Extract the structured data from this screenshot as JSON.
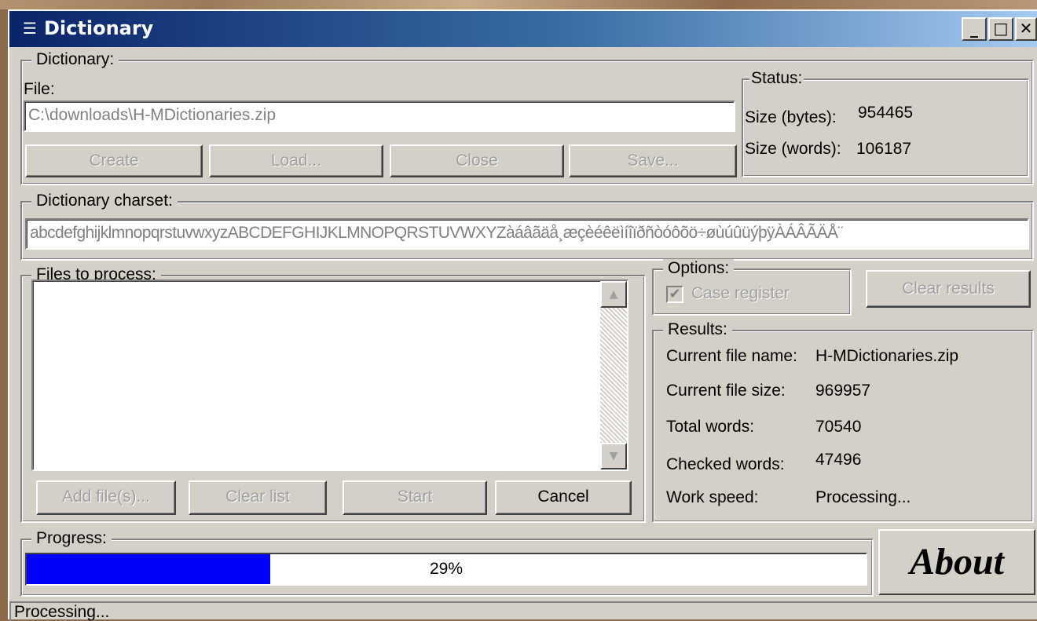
{
  "window": {
    "title": "Dictionary"
  },
  "dictionary": {
    "legend": "Dictionary:",
    "file_label": "File:",
    "file_value": "C:\\downloads\\H-MDictionaries.zip",
    "buttons": {
      "create": "Create",
      "load": "Load...",
      "close": "Close",
      "save": "Save..."
    }
  },
  "status": {
    "legend": "Status:",
    "size_bytes_label": "Size (bytes):",
    "size_bytes_value": "954465",
    "size_words_label": "Size (words):",
    "size_words_value": "106187"
  },
  "charset": {
    "legend": "Dictionary charset:",
    "value": "abcdefghijklmnopqrstuvwxyzABCDEFGHIJKLMNOPQRSTUVWXYZàáâãäå¸æçèéêëìíîïðñòóôõö÷øùúûüýþÿÀÁÂÃÄÅ¨"
  },
  "files": {
    "legend": "Files to process:",
    "buttons": {
      "add": "Add file(s)...",
      "clear": "Clear list",
      "start": "Start",
      "cancel": "Cancel"
    }
  },
  "options": {
    "legend": "Options:",
    "case_register": "Case register",
    "case_register_checked": true,
    "clear_results": "Clear results"
  },
  "results": {
    "legend": "Results:",
    "current_file_name_label": "Current file name:",
    "current_file_name_value": "H-MDictionaries.zip",
    "current_file_size_label": "Current file size:",
    "current_file_size_value": "969957",
    "total_words_label": "Total words:",
    "total_words_value": "70540",
    "checked_words_label": "Checked words:",
    "checked_words_value": "47496",
    "work_speed_label": "Work speed:",
    "work_speed_value": "Processing..."
  },
  "progress": {
    "legend": "Progress:",
    "percent": 29,
    "percent_text": "29%"
  },
  "about_button": "About",
  "statusbar": {
    "text": "Processing..."
  },
  "colors": {
    "progress_fill": "#0000ff",
    "titlebar_start": "#0a246a",
    "face": "#d4d0c8"
  }
}
